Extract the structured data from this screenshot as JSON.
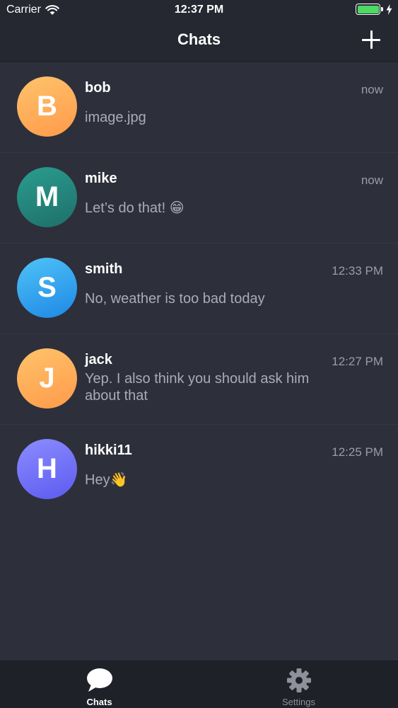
{
  "status_bar": {
    "carrier": "Carrier",
    "time": "12:37 PM",
    "battery_level": 1.0
  },
  "nav": {
    "title": "Chats",
    "add_icon": "plus-icon"
  },
  "chats": [
    {
      "initial": "B",
      "name": "bob",
      "time": "now",
      "preview": "image.jpg",
      "avatar_from": "#ffc36b",
      "avatar_to": "#ff9a4a"
    },
    {
      "initial": "M",
      "name": "mike",
      "time": "now",
      "preview": "Let’s do that! 😁",
      "avatar_from": "#2a9d8f",
      "avatar_to": "#1e6f6a"
    },
    {
      "initial": "S",
      "name": "smith",
      "time": "12:33 PM",
      "preview": "No, weather is too bad today",
      "avatar_from": "#4fc3f7",
      "avatar_to": "#1e88e5"
    },
    {
      "initial": "J",
      "name": "jack",
      "time": "12:27 PM",
      "preview": "Yep. I also think you should ask him about that",
      "avatar_from": "#ffc36b",
      "avatar_to": "#ff9a4a"
    },
    {
      "initial": "H",
      "name": "hikki11",
      "time": "12:25 PM",
      "preview": "Hey👋",
      "avatar_from": "#8c8cff",
      "avatar_to": "#5b5bf0"
    }
  ],
  "tab_bar": {
    "chats_label": "Chats",
    "chats_icon": "chat-bubble-icon",
    "settings_label": "Settings",
    "settings_icon": "gear-icon",
    "active": "chats"
  },
  "colors": {
    "background": "#2d2f3b",
    "header": "#252731",
    "tab_bar": "#1f2129",
    "battery": "#4cd964"
  }
}
